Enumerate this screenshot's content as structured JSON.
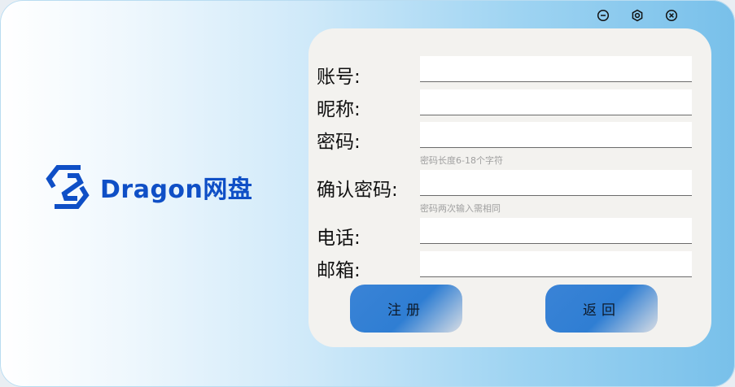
{
  "app": {
    "logo_text": "Dragon网盘"
  },
  "titlebar": {
    "minimize_icon": "minus-circle-icon",
    "settings_icon": "hexagon-gear-icon",
    "close_icon": "x-circle-icon"
  },
  "form": {
    "account_label": "账号:",
    "account_value": "",
    "nickname_label": "昵称:",
    "nickname_value": "",
    "password_label": "密码:",
    "password_value": "",
    "password_hint": "密码长度6-18个字符",
    "confirm_label": "确认密码:",
    "confirm_value": "",
    "confirm_hint": "密码两次输入需相同",
    "phone_label": "电话:",
    "phone_value": "",
    "email_label": "邮箱:",
    "email_value": ""
  },
  "buttons": {
    "register": "注册",
    "back": "返回"
  },
  "colors": {
    "brand": "#0f4fc6",
    "button_blue": "#2f7ed3",
    "panel": "#f3f2ef"
  }
}
